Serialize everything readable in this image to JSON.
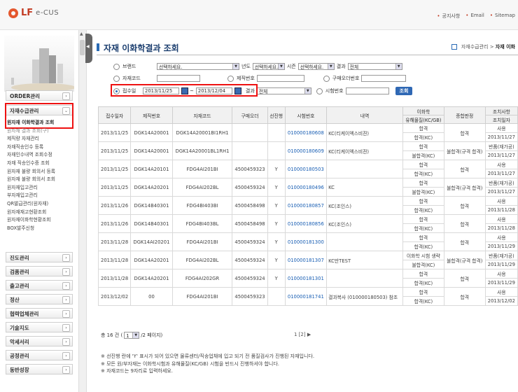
{
  "header": {
    "logo_lf": "LF",
    "logo_ecus": "e-CUS",
    "links": [
      "공지사항",
      "Email",
      "Sitemap"
    ]
  },
  "sidebar": {
    "menu": [
      {
        "label": "ORDER관리"
      },
      {
        "label": "자재수급관리"
      },
      {
        "label": "진도관리"
      },
      {
        "label": "검품관리"
      },
      {
        "label": "출고관리"
      },
      {
        "label": "정산"
      },
      {
        "label": "협력업체관리"
      },
      {
        "label": "기술지도"
      },
      {
        "label": "악세서리"
      },
      {
        "label": "공정관리"
      },
      {
        "label": "동반성장"
      }
    ],
    "submenu": [
      "원자재 이화학결과 조회",
      "원자재 결과 조회(구)",
      "제직량 자재관리",
      "자재직송인수 등록",
      "자재인수내역 조회수정",
      "자재 직송인수증 조회",
      "원자재 불량 회의서 등록",
      "원자재 불량 회의서 조회",
      "원자재입고관리",
      "부자재입고관리",
      "QR발급관리(원자재)",
      "원자재재고현황조회",
      "원자재이화학현황조회",
      "BOX발주신청"
    ]
  },
  "page": {
    "title": "자재 이화학결과 조회",
    "breadcrumb_parent": "자재수급관리",
    "breadcrumb_current": "자재 이화"
  },
  "search": {
    "brand_label": "브랜드",
    "brand_value": "선택하세요.",
    "year_label": "년도",
    "year_value": "선택하세요.",
    "season_label": "시즌",
    "season_value": "선택하세요.",
    "result_label": "결과",
    "result_value": "전체",
    "material_code_label": "자재코드",
    "product_no_label": "제직번호",
    "po_no_label": "구매오더번호",
    "receipt_date_label": "접수일",
    "date_from": "2013/11/25",
    "date_to": "2013/12/04",
    "tilde": "~",
    "result2_label": "결과",
    "result2_value": "전체",
    "test_no_label": "시험번호",
    "search_button": "조회"
  },
  "table": {
    "headers": {
      "receipt_date": "접수일자",
      "product_no": "제직번호",
      "material_code": "자재코드",
      "po": "구매오더",
      "pre_ship": "선진행",
      "test_no": "시험번호",
      "content": "내역",
      "chem_group": "이화학",
      "chem_sub": "유해물질(KC/GB)",
      "overall": "종합판정",
      "action_group": "조치사항",
      "action_date": "조치일자"
    },
    "rows": [
      {
        "date": "2013/11/25",
        "prod": "DGK14A20001",
        "code": "DGK14A20001BI1RH1",
        "po": "",
        "pre": "",
        "test": "010000180608",
        "content": "KC(티케이엑스비젼)",
        "chem1": "합격",
        "chem2": "합격(KC)",
        "overall": "합격",
        "act1": "사용",
        "act2": "2013/11/27"
      },
      {
        "date": "2013/11/25",
        "prod": "DGK14A20001",
        "code": "DGK14A20001BL1RH1",
        "po": "",
        "pre": "",
        "test": "010000180609",
        "content": "KC(티케이엑스비젼)",
        "chem1": "합격",
        "chem2": "불합격(KC)",
        "overall": "불합격(규격 합격)",
        "act1": "반품(재가공)",
        "act2": "2013/11/27"
      },
      {
        "date": "2013/11/25",
        "prod": "DGK14A20101",
        "code": "FDG4AI201BI",
        "po": "4500459323",
        "pre": "Y",
        "test": "010000180503",
        "content": "",
        "chem1": "합격",
        "chem2": "합격(KC)",
        "overall": "합격",
        "act1": "사용",
        "act2": "2013/11/27"
      },
      {
        "date": "2013/11/25",
        "prod": "DGK14A20201",
        "code": "FDG4AI202BL",
        "po": "4500459324",
        "pre": "Y",
        "test": "010000180496",
        "content": "KC",
        "chem1": "합격",
        "chem2": "불합격(KC)",
        "overall": "불합격(규격 합격)",
        "act1": "반품(재가공)",
        "act2": "2013/11/27"
      },
      {
        "date": "2013/11/26",
        "prod": "DGK14B40301",
        "code": "FDG4BI403BI",
        "po": "4500458498",
        "pre": "Y",
        "test": "010000180857",
        "content": "KC(조인스)",
        "chem1": "합격",
        "chem2": "합격(KC)",
        "overall": "합격",
        "act1": "사용",
        "act2": "2013/11/28"
      },
      {
        "date": "2013/11/26",
        "prod": "DGK14B40301",
        "code": "FDG4BI403BL",
        "po": "4500458498",
        "pre": "Y",
        "test": "010000180856",
        "content": "KC(조인스)",
        "chem1": "합격",
        "chem2": "합격(KC)",
        "overall": "합격",
        "act1": "사용",
        "act2": "2013/11/28"
      },
      {
        "date": "2013/11/28",
        "prod": "DGK14AI20201",
        "code": "FDG4AI201BI",
        "po": "4500459324",
        "pre": "Y",
        "test": "010000181300",
        "content": "",
        "chem1": "합격",
        "chem2": "합격(KC)",
        "overall": "합격",
        "act1": "사용",
        "act2": "2013/11/29"
      },
      {
        "date": "2013/11/28",
        "prod": "DGK14A20201",
        "code": "FDG4AI202BL",
        "po": "4500459324",
        "pre": "Y",
        "test": "010000181307",
        "content": "KC만TEST",
        "chem1": "이화학 시험 생략",
        "chem2": "불합격(KC)",
        "overall": "불합격(규격 합격)",
        "act1": "반품(재가공)",
        "act2": "2013/11/29"
      },
      {
        "date": "2013/11/28",
        "prod": "DGK14A20201",
        "code": "FDG4AI202GR",
        "po": "4500459324",
        "pre": "Y",
        "test": "010000181301",
        "content": "",
        "chem1": "합격",
        "chem2": "합격(KC)",
        "overall": "합격",
        "act1": "사용",
        "act2": "2013/11/29"
      },
      {
        "date": "2013/12/02",
        "prod": "00",
        "code": "FDG4AI201BI",
        "po": "4500459323",
        "pre": "",
        "test": "010000181741",
        "content": "결과복사 (010000180503) 참조",
        "chem1": "합격",
        "chem2": "합격(KC)",
        "overall": "합격",
        "act1": "사용",
        "act2": "2013/12/02"
      }
    ]
  },
  "footer": {
    "total_prefix": "총 16 건 (",
    "page_select": "1",
    "total_suffix": "/2 페이지)",
    "pager": "1 [2] ▶",
    "notes": [
      "※ 선진행 란에 'Y' 표시가 되어 있으면 물류센터/직송업체에 입고 되기 전 품질검사가 진행된 자재입니다.",
      "※ 모든 원/부자재는 이화학시험과 유해물질(KC/GB) 시험을 반드시 진행하셔야 합니다.",
      "※ 자재코드는 9자리로 입력하세요."
    ]
  },
  "colors": {
    "accent": "#c23b22",
    "title_blue": "#1a3d6e",
    "link_blue": "#1a5fb4",
    "highlight_red": "#ee1111"
  }
}
